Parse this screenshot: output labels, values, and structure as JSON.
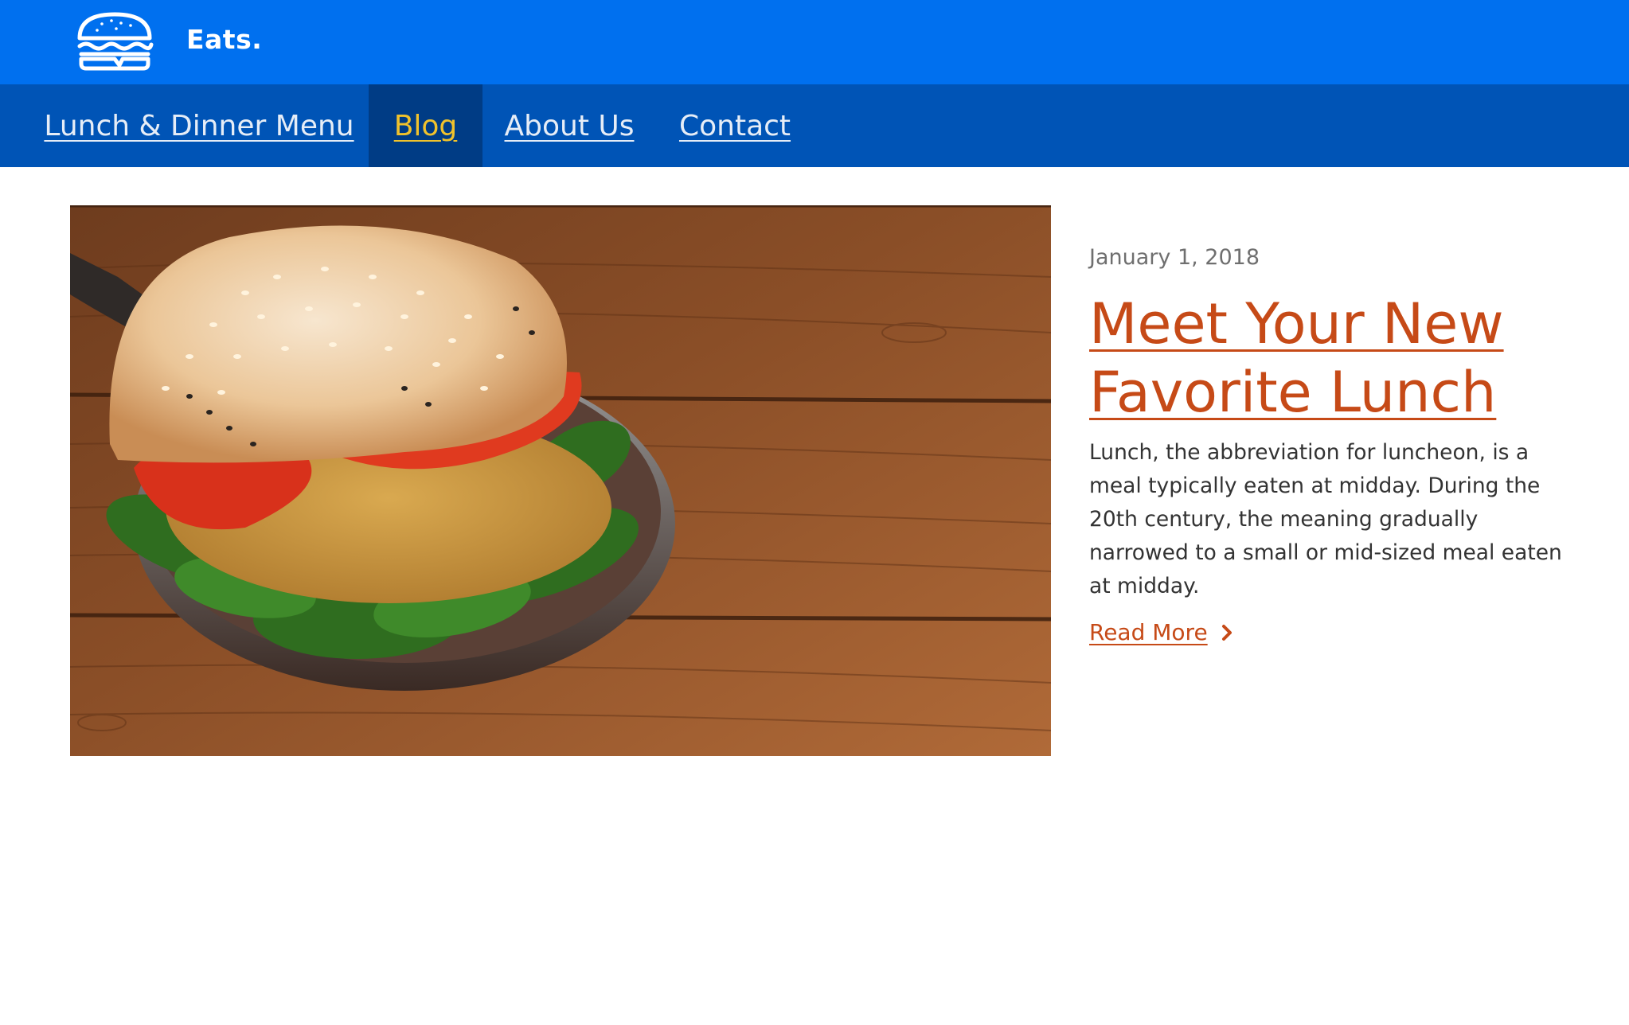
{
  "header": {
    "brand": "Eats.",
    "logo_icon": "burger-icon"
  },
  "nav": {
    "items": [
      {
        "label": "Lunch & Dinner Menu",
        "active": false
      },
      {
        "label": "Blog",
        "active": true
      },
      {
        "label": "About Us",
        "active": false
      },
      {
        "label": "Contact",
        "active": false
      }
    ]
  },
  "post": {
    "date": "January 1, 2018",
    "title": "Meet Your New Favorite Lunch",
    "excerpt": "Lunch, the abbreviation for luncheon, is a meal typically eaten at midday. During the 20th century, the meaning gradually narrowed to a small or mid-sized meal eaten at midday.",
    "read_more_label": "Read More",
    "read_more_icon": "chevron-right-icon"
  },
  "colors": {
    "header_blue": "#0070ef",
    "nav_blue": "#0054b6",
    "nav_active": "#003c85",
    "nav_active_text": "#f0c22c",
    "accent_orange": "#c64a17"
  }
}
